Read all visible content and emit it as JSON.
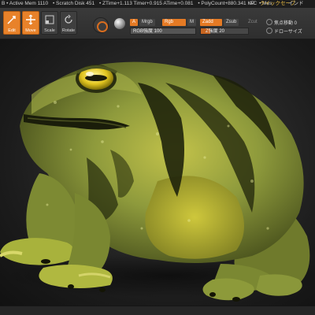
{
  "status_bar": {
    "items": [
      "B • Active Mem 1110",
      "• Scratch Disk 451",
      "• ZTime+1.113 Timer+0.915 ATime+0.081",
      "• PolyCount+880.341 KP",
      "• Mes"
    ],
    "right_items": [
      "AC",
      "クイックセーブ",
      "インド"
    ]
  },
  "toolbar": {
    "buttons": [
      {
        "label": "Edit",
        "name": "edit",
        "active": true
      },
      {
        "label": "Move",
        "name": "move",
        "active": true
      },
      {
        "label": "Scale",
        "name": "scale",
        "active": false
      },
      {
        "label": "Rotate",
        "name": "rotate",
        "active": false
      }
    ],
    "channel_a": "A",
    "mrgb": "Mrgb",
    "rgb": "Rgb",
    "m": "M",
    "zadd": "Zadd",
    "zsub": "Zsub",
    "zcut": "Zcut",
    "rgb_intensity": "RGB強度 100",
    "z_intensity": "Z強度 20",
    "right_labels": [
      "焦点移動 0",
      "ドローサイズ"
    ]
  },
  "colors": {
    "accent": "#e57a24",
    "frog_body": "#8d9a3a",
    "frog_dark": "#1f230b",
    "frog_yellow": "#d4c32a"
  }
}
